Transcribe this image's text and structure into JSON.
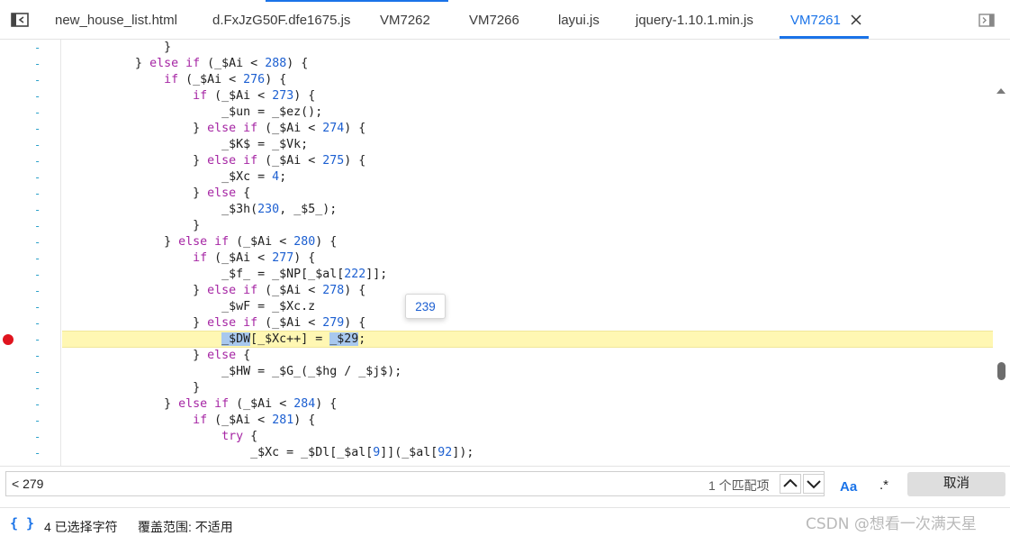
{
  "tabs": [
    {
      "label": "new_house_list.html",
      "active": false
    },
    {
      "label": "d.FxJzG50F.dfe1675.js",
      "active": false
    },
    {
      "label": "VM7262",
      "active": false
    },
    {
      "label": "VM7266",
      "active": false
    },
    {
      "label": "layui.js",
      "active": false
    },
    {
      "label": "jquery-1.10.1.min.js",
      "active": false
    },
    {
      "label": "VM7261",
      "active": true
    }
  ],
  "gutter_marker": "-",
  "breakpoint_line": 18,
  "code_lines": [
    "              }",
    "          } else if (_$Ai < 288) {",
    "              if (_$Ai < 276) {",
    "                  if (_$Ai < 273) {",
    "                      _$un = _$ez();",
    "                  } else if (_$Ai < 274) {",
    "                      _$K$ = _$Vk;",
    "                  } else if (_$Ai < 275) {",
    "                      _$Xc = 4;",
    "                  } else {",
    "                      _$3h(230, _$5_);",
    "                  }",
    "              } else if (_$Ai < 280) {",
    "                  if (_$Ai < 277) {",
    "                      _$f_ = _$NP[_$al[222]];",
    "                  } else if (_$Ai < 278) {",
    "                      _$wF = _$Xc.z",
    "                  } else if (_$Ai < 279) {",
    "                      _$DW[_$Xc++] = _$29;",
    "                  } else {",
    "                      _$HW = _$G_(_$hg / _$j$);",
    "                  }",
    "              } else if (_$Ai < 284) {",
    "                  if (_$Ai < 281) {",
    "                      try {",
    "                          _$Xc = _$Dl[_$al[9]](_$al[92]);"
  ],
  "tooltip_value": "239",
  "search": {
    "value": "< 279",
    "match_count": "1 个匹配项",
    "case_label": "Aa",
    "regex_label": ".*",
    "cancel_label": "取消"
  },
  "status": {
    "braces": "{ }",
    "selected": "4 已选择字符",
    "coverage": "覆盖范围: 不适用"
  },
  "watermark": "CSDN @想看一次满天星",
  "colors": {
    "accent": "#1a73e8",
    "keyword": "#a626a4",
    "number": "#1c5fd1",
    "highlight_line": "#fff7b3",
    "breakpoint": "#e0141e"
  }
}
